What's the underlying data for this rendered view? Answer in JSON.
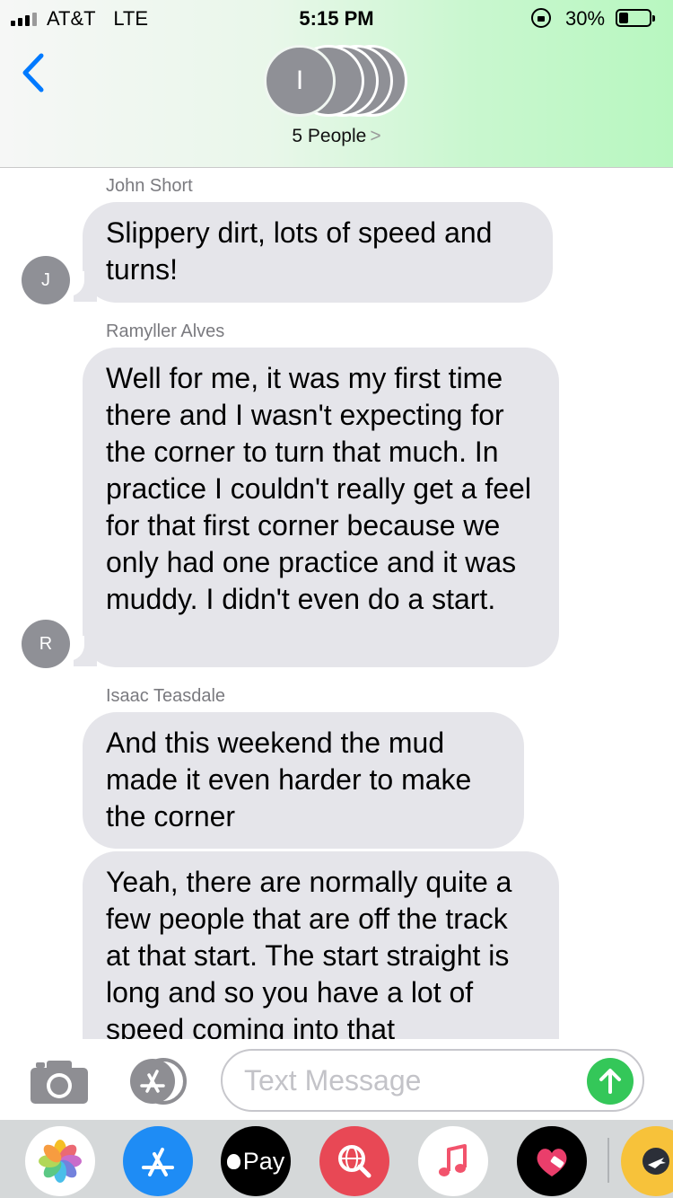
{
  "status_bar": {
    "carrier": "AT&T",
    "network": "LTE",
    "time": "5:15 PM",
    "battery": "30%"
  },
  "header": {
    "back_icon": "chevron-left-icon",
    "group_initial": "I",
    "people_label": "5 People",
    "people_chevron": ">"
  },
  "messages": [
    {
      "sender": "John Short",
      "text": "Slippery dirt, lots of speed and turns!",
      "avatar": "J"
    },
    {
      "sender": "Ramyller Alves",
      "text": "Well for me, it was my first time there and I wasn't expecting for the corner to turn that much. In practice I couldn't really get a feel for that first corner because we only had one practice and it was muddy. I didn't even do a start.",
      "avatar": "R"
    },
    {
      "sender": "Isaac Teasdale",
      "text": "And this weekend the mud made it even harder to make the corner"
    },
    {
      "text": "Yeah, there are normally quite a few people that are off the track at that start. The start straight is long and so you have a lot of speed coming into that"
    }
  ],
  "input": {
    "placeholder": "Text Message",
    "value": ""
  },
  "app_drawer": [
    "photos-icon",
    "app-store-icon",
    "apple-pay-icon",
    "web-search-icon",
    "music-icon",
    "heart-app-icon",
    "airplane-app-icon"
  ],
  "apple_pay_label": "Pay",
  "colors": {
    "accent_blue": "#007aff",
    "bubble_gray": "#e5e5ea",
    "send_green": "#34c759"
  }
}
